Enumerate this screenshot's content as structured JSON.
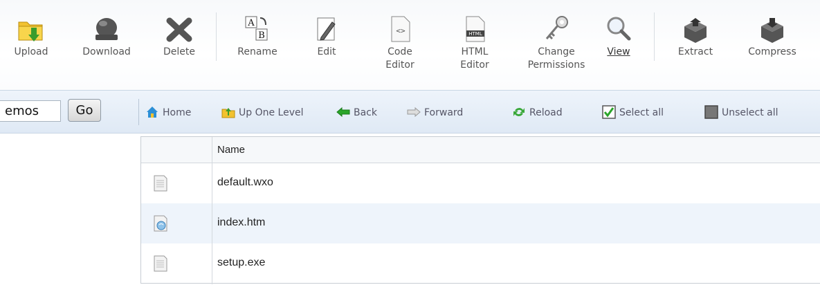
{
  "toolbar": {
    "upload": "Upload",
    "download": "Download",
    "delete": "Delete",
    "rename": "Rename",
    "edit": "Edit",
    "code_editor": "Code\nEditor",
    "html_editor": "HTML\nEditor",
    "change_permissions": "Change\nPermissions",
    "view": "View",
    "extract": "Extract",
    "compress": "Compress"
  },
  "navbar": {
    "directory_value": "emos",
    "go": "Go",
    "home": "Home",
    "up_one_level": "Up One Level",
    "back": "Back",
    "forward": "Forward",
    "reload": "Reload",
    "select_all": "Select all",
    "unselect_all": "Unselect all"
  },
  "table": {
    "header_name": "Name",
    "rows": [
      {
        "name": "default.wxo",
        "icon": "text-file-icon"
      },
      {
        "name": "index.htm",
        "icon": "html-file-icon"
      },
      {
        "name": "setup.exe",
        "icon": "text-file-icon"
      }
    ]
  },
  "colors": {
    "nav_background": "#dfe9f5",
    "row_highlight": "#eef4fb",
    "border": "#c7cdd3"
  }
}
